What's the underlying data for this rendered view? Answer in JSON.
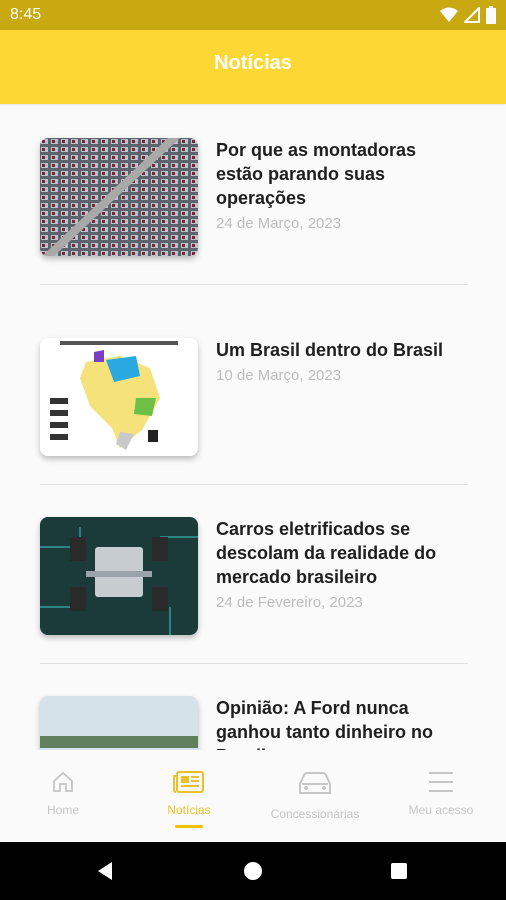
{
  "status_bar": {
    "time": "8:45"
  },
  "header": {
    "title": "Notícias"
  },
  "articles": [
    {
      "title": "Por que as montadoras estão parando suas operações",
      "date": "24 de Março, 2023",
      "image": "parking-lot-aerial"
    },
    {
      "title": "Um Brasil dentro do Brasil",
      "date": "10 de Março, 2023",
      "image": "brazil-map-infographic"
    },
    {
      "title": "Carros eletrificados se descolam da realidade do mercado brasileiro",
      "date": "24 de Fevereiro, 2023",
      "image": "electric-car-chassis"
    },
    {
      "title": "Opinião: A Ford nunca ganhou tanto dinheiro no Brasil",
      "date": "",
      "image": "landscape-photo"
    }
  ],
  "bottom_nav": [
    {
      "label": "Home",
      "icon": "home-icon",
      "active": false
    },
    {
      "label": "Notícias",
      "icon": "newspaper-icon",
      "active": true
    },
    {
      "label": "Concessionárias",
      "icon": "car-icon",
      "active": false
    },
    {
      "label": "Meu acesso",
      "icon": "menu-icon",
      "active": false
    }
  ],
  "colors": {
    "header": "#fdd835",
    "status_bar": "#c9a912",
    "nav_active": "#e9c22a"
  }
}
